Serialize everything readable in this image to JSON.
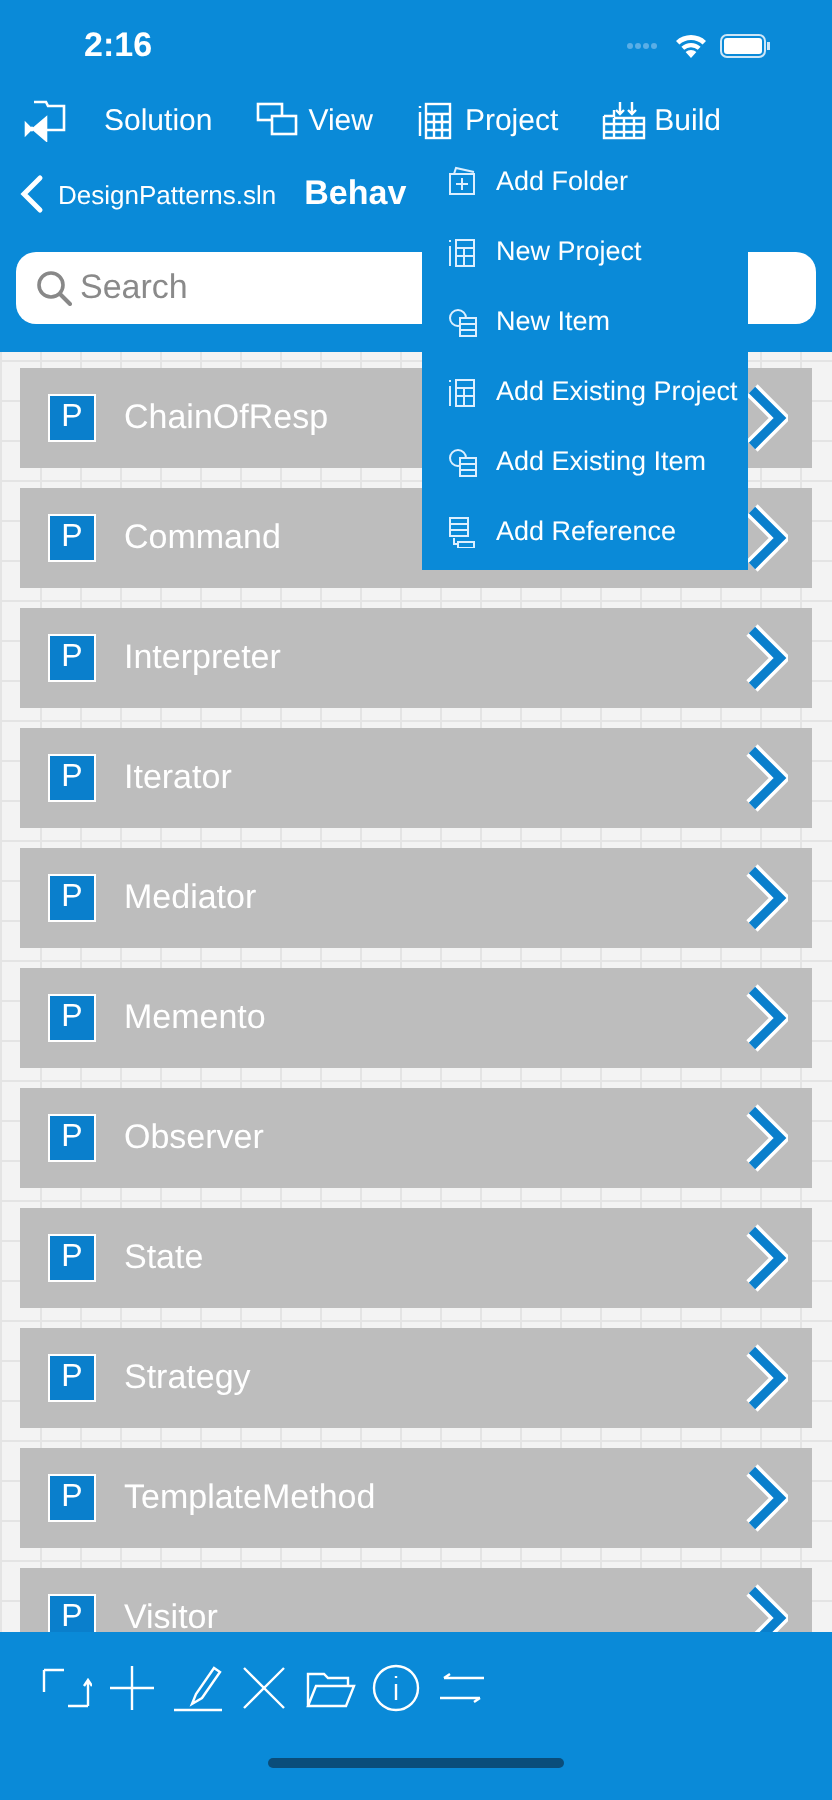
{
  "status_bar": {
    "time": "2:16"
  },
  "menu_bar": [
    {
      "label": "Solution"
    },
    {
      "label": "View"
    },
    {
      "label": "Project"
    },
    {
      "label": "Build"
    }
  ],
  "nav": {
    "back": "DesignPatterns.sln",
    "title": "Behav"
  },
  "search": {
    "placeholder": "Search"
  },
  "projects": [
    {
      "badge": "P",
      "name": "ChainOfResp"
    },
    {
      "badge": "P",
      "name": "Command"
    },
    {
      "badge": "P",
      "name": "Interpreter"
    },
    {
      "badge": "P",
      "name": "Iterator"
    },
    {
      "badge": "P",
      "name": "Mediator"
    },
    {
      "badge": "P",
      "name": "Memento"
    },
    {
      "badge": "P",
      "name": "Observer"
    },
    {
      "badge": "P",
      "name": "State"
    },
    {
      "badge": "P",
      "name": "Strategy"
    },
    {
      "badge": "P",
      "name": "TemplateMethod"
    },
    {
      "badge": "P",
      "name": "Visitor"
    }
  ],
  "dropdown": [
    {
      "label": "Add Folder"
    },
    {
      "label": "New Project"
    },
    {
      "label": "New Item"
    },
    {
      "label": "Add Existing Project"
    },
    {
      "label": "Add Existing Item"
    },
    {
      "label": "Add Reference"
    }
  ],
  "toolbar": [
    {
      "kind": "refresh"
    },
    {
      "kind": "add"
    },
    {
      "kind": "edit"
    },
    {
      "kind": "delete"
    },
    {
      "kind": "folder"
    },
    {
      "kind": "info"
    },
    {
      "kind": "swap"
    }
  ]
}
